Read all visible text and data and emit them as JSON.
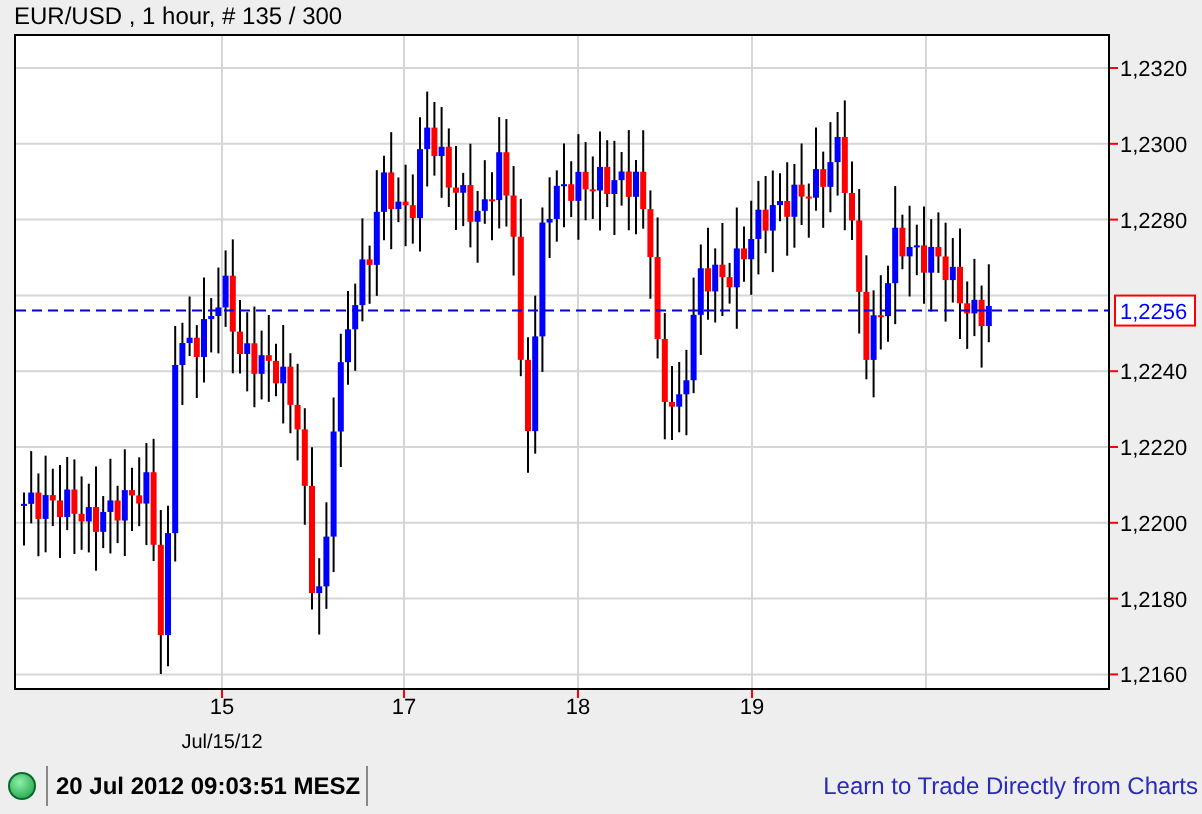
{
  "title": "EUR/USD , 1 hour, # 135 / 300",
  "y_axis": {
    "ticks": [
      "1,2320",
      "1,2300",
      "1,2280",
      "1,2240",
      "1,2220",
      "1,2200",
      "1,2180",
      "1,2160"
    ],
    "current_price": "1,2256"
  },
  "x_axis": {
    "ticks": [
      "15",
      "17",
      "18",
      "19"
    ],
    "date_label": "Jul/15/12"
  },
  "status_bar": {
    "time": "20 Jul 2012 09:03:51 MESZ",
    "link": "Learn to Trade Directly from Charts"
  }
}
